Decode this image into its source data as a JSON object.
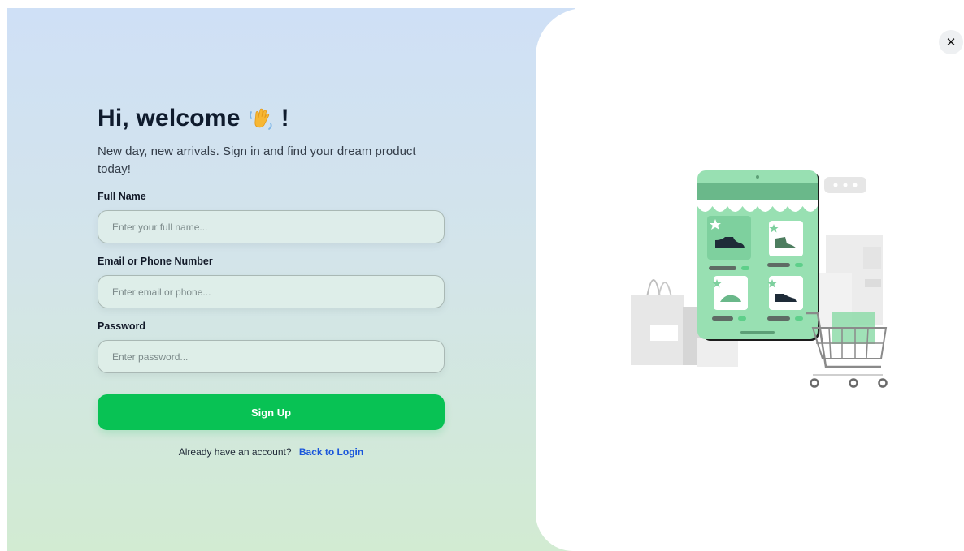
{
  "header": {
    "title": "Hi, welcome",
    "title_suffix": "!",
    "subtitle": "New day, new arrivals. Sign in and find your dream product today!",
    "wave_icon": "waving-hand-icon"
  },
  "form": {
    "full_name": {
      "label": "Full Name",
      "placeholder": "Enter your full name...",
      "value": ""
    },
    "contact": {
      "label": "Email or Phone Number",
      "placeholder": "Enter email or phone...",
      "value": ""
    },
    "password": {
      "label": "Password",
      "placeholder": "Enter password...",
      "value": ""
    },
    "submit_label": "Sign Up"
  },
  "footer": {
    "prompt": "Already have an account?",
    "link_label": "Back to Login"
  },
  "close": {
    "label": "✕",
    "icon": "close-icon"
  },
  "illustration": {
    "icon": "online-store-icon"
  },
  "colors": {
    "accent": "#08c254",
    "link": "#1a56db",
    "illustration_green": "#8fdcaa",
    "gradient_top": "#cfe0f6",
    "gradient_bottom": "#d2ebd2"
  }
}
